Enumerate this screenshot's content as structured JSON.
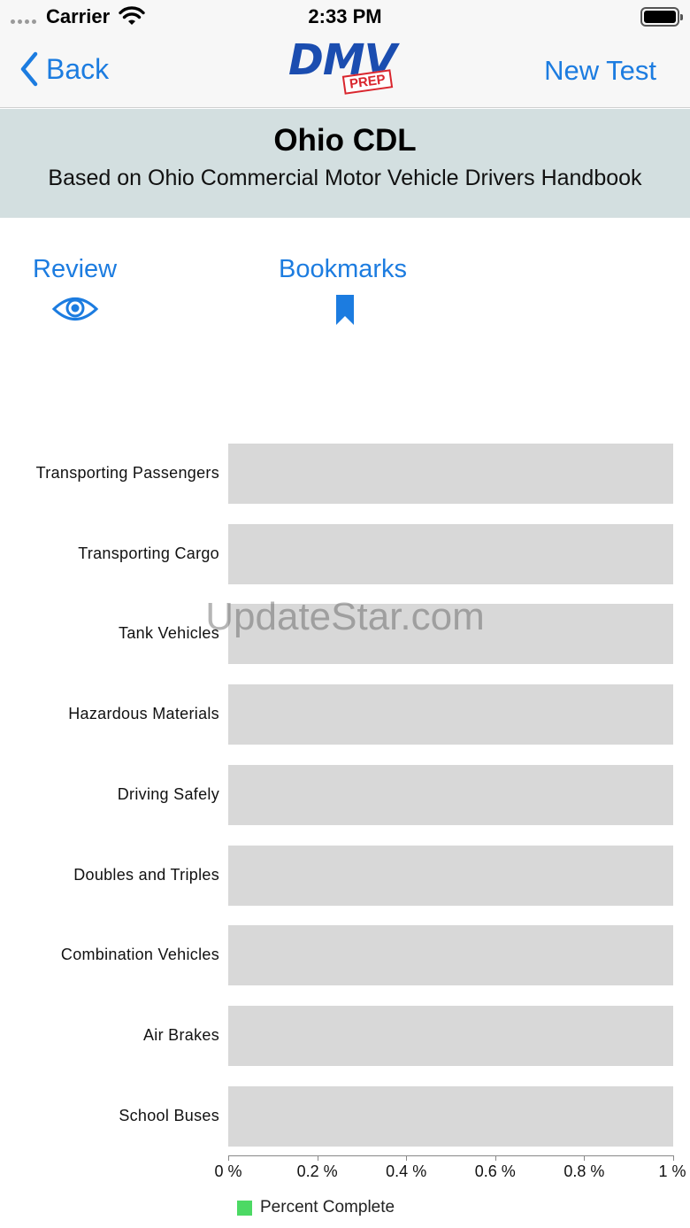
{
  "status_bar": {
    "carrier": "Carrier",
    "time": "2:33 PM"
  },
  "nav": {
    "back_label": "Back",
    "new_test_label": "New Test",
    "logo_text": "DMV",
    "logo_badge": "PREP"
  },
  "header": {
    "title": "Ohio CDL",
    "subtitle": "Based on Ohio Commercial Motor Vehicle Drivers Handbook"
  },
  "actions": {
    "review_label": "Review",
    "bookmarks_label": "Bookmarks"
  },
  "colors": {
    "accent": "#1c7ce0",
    "header_bg": "#d3dfe0",
    "bar_bg": "#d8d8d8",
    "complete": "#4cd964"
  },
  "chart_data": {
    "type": "bar",
    "orientation": "horizontal",
    "categories": [
      "Transporting Passengers",
      "Transporting Cargo",
      "Tank Vehicles",
      "Hazardous Materials",
      "Driving Safely",
      "Doubles and Triples",
      "Combination Vehicles",
      "Air Brakes",
      "School Buses"
    ],
    "series": [
      {
        "name": "Percent Complete",
        "values": [
          0,
          0,
          0,
          0,
          0,
          0,
          0,
          0,
          0
        ]
      }
    ],
    "xlim": [
      0,
      1
    ],
    "x_ticks": [
      "0 %",
      "0.2 %",
      "0.4 %",
      "0.6 %",
      "0.8 %",
      "1 %"
    ],
    "legend_position": "bottom-left"
  },
  "watermark": "UpdateStar.com"
}
